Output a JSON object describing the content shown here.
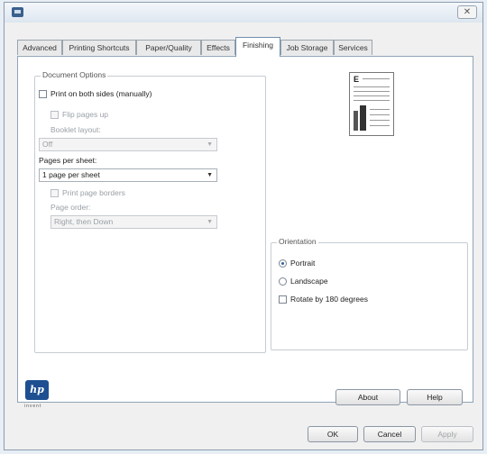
{
  "window": {
    "close_glyph": "✕"
  },
  "tabs": [
    {
      "label": "Advanced"
    },
    {
      "label": "Printing Shortcuts"
    },
    {
      "label": "Paper/Quality"
    },
    {
      "label": "Effects"
    },
    {
      "label": "Finishing"
    },
    {
      "label": "Job Storage"
    },
    {
      "label": "Services"
    }
  ],
  "active_tab": "Finishing",
  "document_options": {
    "legend": "Document Options",
    "print_both_sides": {
      "label": "Print on both sides (manually)",
      "checked": false
    },
    "flip_pages_up": {
      "label": "Flip pages up",
      "checked": false
    },
    "booklet_layout": {
      "label": "Booklet layout:",
      "value": "Off"
    },
    "pages_per_sheet": {
      "label": "Pages per sheet:",
      "value": "1 page per sheet"
    },
    "print_page_borders": {
      "label": "Print page borders",
      "checked": false
    },
    "page_order": {
      "label": "Page order:",
      "value": "Right, then Down"
    }
  },
  "orientation": {
    "legend": "Orientation",
    "portrait": {
      "label": "Portrait",
      "checked": true
    },
    "landscape": {
      "label": "Landscape",
      "checked": false
    },
    "rotate": {
      "label": "Rotate by 180 degrees",
      "checked": false
    }
  },
  "preview": {
    "letter": "E"
  },
  "logo": {
    "text": "hp",
    "tagline": "invent"
  },
  "buttons": {
    "about": "About",
    "help": "Help",
    "ok": "OK",
    "cancel": "Cancel",
    "apply": "Apply"
  }
}
